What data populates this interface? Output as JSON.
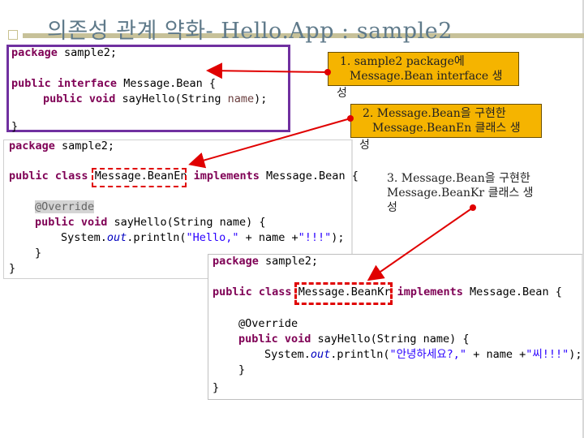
{
  "slide": {
    "title": "의존성 관계 약화- Hello.App : sample2"
  },
  "code_interface": {
    "l1_kw": "package",
    "l1_rest": " sample2;",
    "l3_kw1": "public",
    "l3_kw2": " interface",
    "l3_rest": " Message.Bean {",
    "l4_kw1": "public",
    "l4_kw2": " void",
    "l4_mid": " sayHello(String ",
    "l4_par": "name",
    "l4_end": ");",
    "l5": "}"
  },
  "code_en": {
    "l1_kw": "package",
    "l1_rest": " sample2;",
    "l3_kw1": "public",
    "l3_kw2": " class",
    "l3_name": "Message.BeanEn",
    "l3_kw3": " implements",
    "l3_rest": " Message.Bean {",
    "l5_ann": "@Override",
    "l6_kw1": "public",
    "l6_kw2": " void",
    "l6_rest": " sayHello(String name) {",
    "l7_a": "System.",
    "l7_fld": "out",
    "l7_b": ".println(",
    "l7_str1": "\"Hello,\"",
    "l7_c": " + name +",
    "l7_str2": "\"!!!\"",
    "l7_d": ");",
    "l8": "}",
    "l9": "}"
  },
  "code_kr": {
    "l1_kw": "package",
    "l1_rest": " sample2;",
    "l3_kw1": "public",
    "l3_kw2": " class",
    "l3_name": "Message.BeanKr",
    "l3_kw3": " implements",
    "l3_rest": " Message.Bean {",
    "l5_ann": "@Override",
    "l6_kw1": "public",
    "l6_kw2": " void",
    "l6_rest": " sayHello(String name) {",
    "l7_a": "System.",
    "l7_fld": "out",
    "l7_b": ".println(",
    "l7_str1": "\"안녕하세요?,\"",
    "l7_c": " + name +",
    "l7_str2": "\"씨!!!\"",
    "l7_d": ");",
    "l8": "}",
    "l9": "}"
  },
  "callouts": {
    "c1_line1": "1. sample2 package에",
    "c1_line2": "Message.Bean interface 생",
    "c1_tail": "성",
    "c2_line1": "2. Message.Bean을 구현한",
    "c2_line2": "Message.BeanEn 클래스 생",
    "c2_tail": "성",
    "c3_line1": "3. Message.Bean을 구현한",
    "c3_line2": "Message.BeanKr 클래스 생",
    "c3_tail": "성"
  },
  "colors": {
    "accent_red": "#e00000",
    "callout_fill": "#f5b400",
    "interface_border": "#7030a0"
  }
}
